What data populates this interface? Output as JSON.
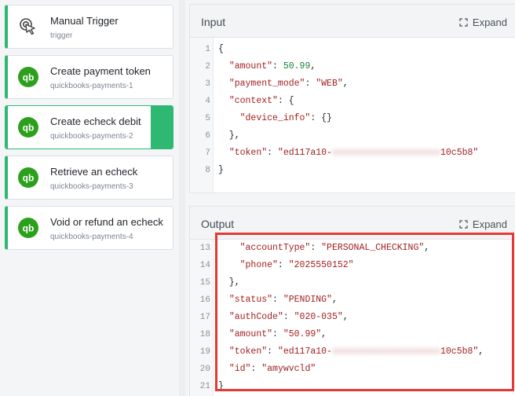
{
  "steps": [
    {
      "title": "Manual Trigger",
      "subtitle": "trigger",
      "icon": "manual-trigger-icon",
      "active": false
    },
    {
      "title": "Create payment token",
      "subtitle": "quickbooks-payments-1",
      "icon": "quickbooks-icon",
      "active": false
    },
    {
      "title": "Create echeck debit",
      "subtitle": "quickbooks-payments-2",
      "icon": "quickbooks-icon",
      "active": true
    },
    {
      "title": "Retrieve an echeck",
      "subtitle": "quickbooks-payments-3",
      "icon": "quickbooks-icon",
      "active": false
    },
    {
      "title": "Void or refund an echeck",
      "subtitle": "quickbooks-payments-4",
      "icon": "quickbooks-icon",
      "active": false
    }
  ],
  "input": {
    "title": "Input",
    "expand_label": "Expand",
    "lines": [
      {
        "n": "1",
        "text": "{"
      },
      {
        "n": "2",
        "text": "  \"amount\": 50.99,"
      },
      {
        "n": "3",
        "text": "  \"payment_mode\": \"WEB\","
      },
      {
        "n": "4",
        "text": "  \"context\": {"
      },
      {
        "n": "5",
        "text": "    \"device_info\": {}"
      },
      {
        "n": "6",
        "text": "  },"
      },
      {
        "n": "7",
        "text": "  \"token\": \"ed117a10-xxxxxxxxxxxxxxxxxxxx10c5b8\""
      },
      {
        "n": "8",
        "text": "}"
      }
    ]
  },
  "output": {
    "title": "Output",
    "expand_label": "Expand",
    "lines": [
      {
        "n": "13",
        "text": "    \"accountType\": \"PERSONAL_CHECKING\","
      },
      {
        "n": "14",
        "text": "    \"phone\": \"2025550152\""
      },
      {
        "n": "15",
        "text": "  },"
      },
      {
        "n": "16",
        "text": "  \"status\": \"PENDING\","
      },
      {
        "n": "17",
        "text": "  \"authCode\": \"020-035\","
      },
      {
        "n": "18",
        "text": "  \"amount\": \"50.99\","
      },
      {
        "n": "19",
        "text": "  \"token\": \"ed117a10-xxxxxxxxxxxxxxxxxxxx10c5b8\","
      },
      {
        "n": "20",
        "text": "  \"id\": \"amywvcld\""
      },
      {
        "n": "21",
        "text": "}"
      }
    ]
  },
  "colors": {
    "accent": "#2eb872",
    "quickbooks": "#2ca01c",
    "highlight": "#e53935"
  }
}
